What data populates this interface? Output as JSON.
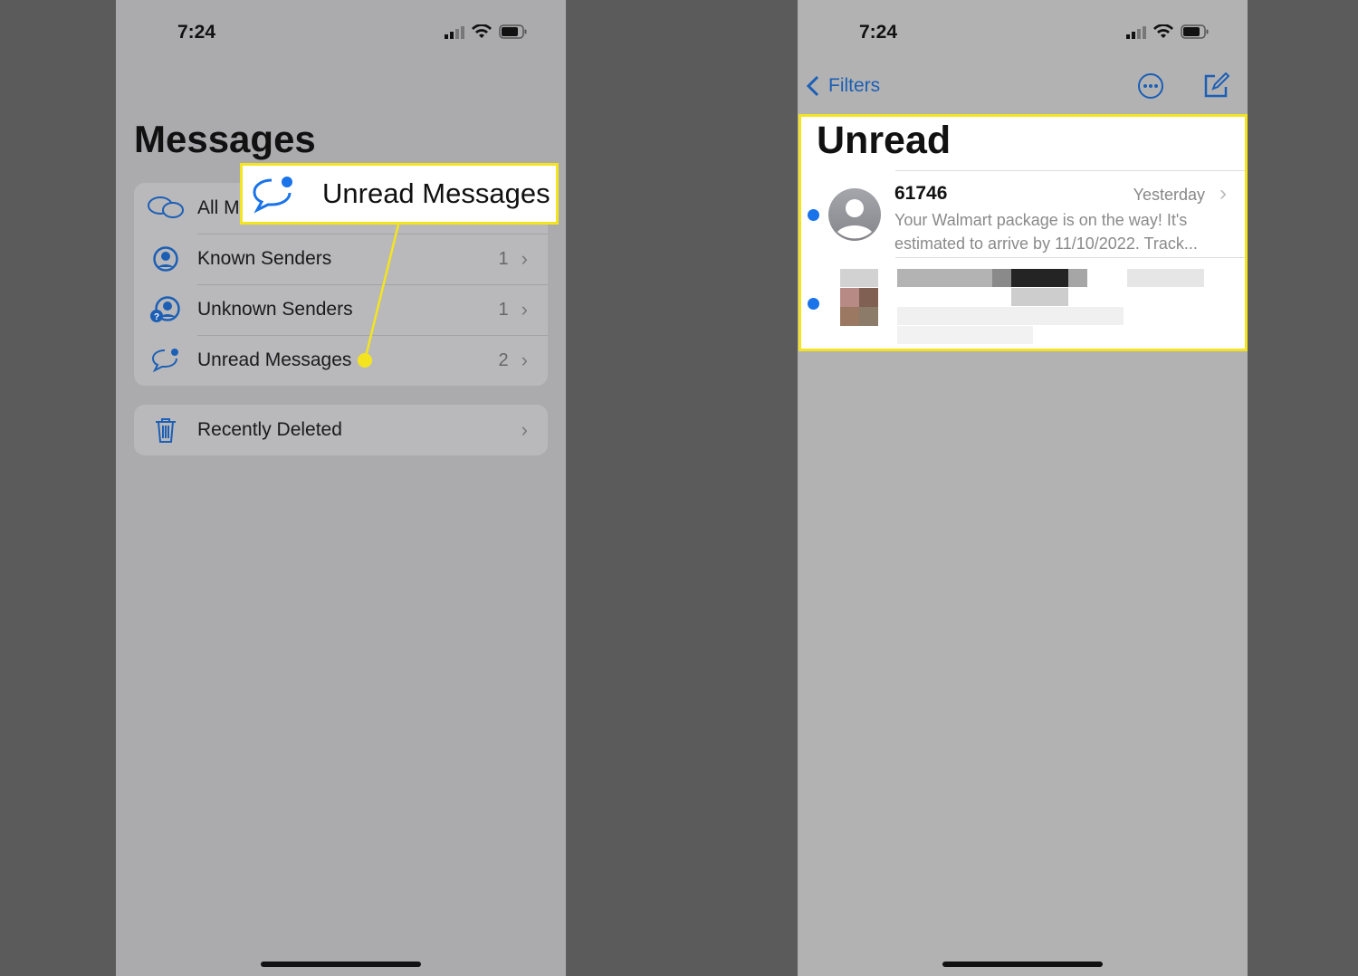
{
  "left_screen": {
    "status_bar": {
      "time": "7:24"
    },
    "title": "Messages",
    "filters": [
      {
        "label": "All Messages",
        "visible_label": "All M",
        "icon": "bubbles-icon",
        "count": ""
      },
      {
        "label": "Known Senders",
        "icon": "person-circle-icon",
        "count": "1"
      },
      {
        "label": "Unknown Senders",
        "icon": "person-question-icon",
        "count": "1"
      },
      {
        "label": "Unread Messages",
        "icon": "unread-bubble-icon",
        "count": "2"
      }
    ],
    "recently_deleted": {
      "label": "Recently Deleted",
      "icon": "trash-icon"
    },
    "callout": {
      "label": "Unread Messages",
      "color": "#f4e41f"
    }
  },
  "right_screen": {
    "status_bar": {
      "time": "7:24"
    },
    "back_label": "Filters",
    "title": "Unread",
    "messages": [
      {
        "sender": "61746",
        "time": "Yesterday",
        "preview_line1": "Your Walmart package is on the way! It's",
        "preview_line2": "estimated to arrive by 11/10/2022. Track...",
        "unread": true
      },
      {
        "sender": "",
        "blurred": true,
        "unread": true
      }
    ]
  },
  "colors": {
    "accent": "#1c5fb5",
    "unread_dot": "#1a73e8",
    "highlight": "#f4e41f"
  }
}
